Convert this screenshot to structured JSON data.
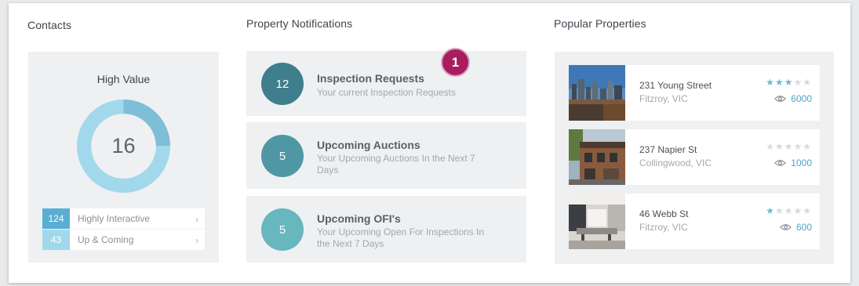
{
  "contacts": {
    "title": "Contacts",
    "panel_title": "High Value",
    "total": "16",
    "rows": [
      {
        "count": "124",
        "label": "Highly Interactive",
        "color": "#5aaed5"
      },
      {
        "count": "43",
        "label": "Up & Coming",
        "color": "#a2d8ec"
      }
    ]
  },
  "notifications": {
    "title": "Property Notifications",
    "badge": "1",
    "items": [
      {
        "count": "12",
        "title": "Inspection Requests",
        "subtitle": "Your current Inspection Requests",
        "color": "#3f7e8c"
      },
      {
        "count": "5",
        "title": "Upcoming Auctions",
        "subtitle": "Your Upcoming Auctions In the Next 7 Days",
        "color": "#4f97a4"
      },
      {
        "count": "5",
        "title": "Upcoming OFI's",
        "subtitle": "Your Upcoming Open For Inspections In the Next 7 Days",
        "color": "#68b6be"
      }
    ]
  },
  "properties": {
    "title": "Popular Properties",
    "items": [
      {
        "address": "231 Young Street",
        "suburb": "Fitzroy, VIC",
        "rating": 3,
        "views": "6000"
      },
      {
        "address": "237 Napier St",
        "suburb": "Collingwood, VIC",
        "rating": 0,
        "views": "1000"
      },
      {
        "address": "46 Webb St",
        "suburb": "Fitzroy, VIC",
        "rating": 1,
        "views": "600"
      }
    ]
  },
  "colors": {
    "donut_light": "#a2d8ec",
    "donut_dark": "#7fbed7",
    "badge": "#a71d5d"
  }
}
